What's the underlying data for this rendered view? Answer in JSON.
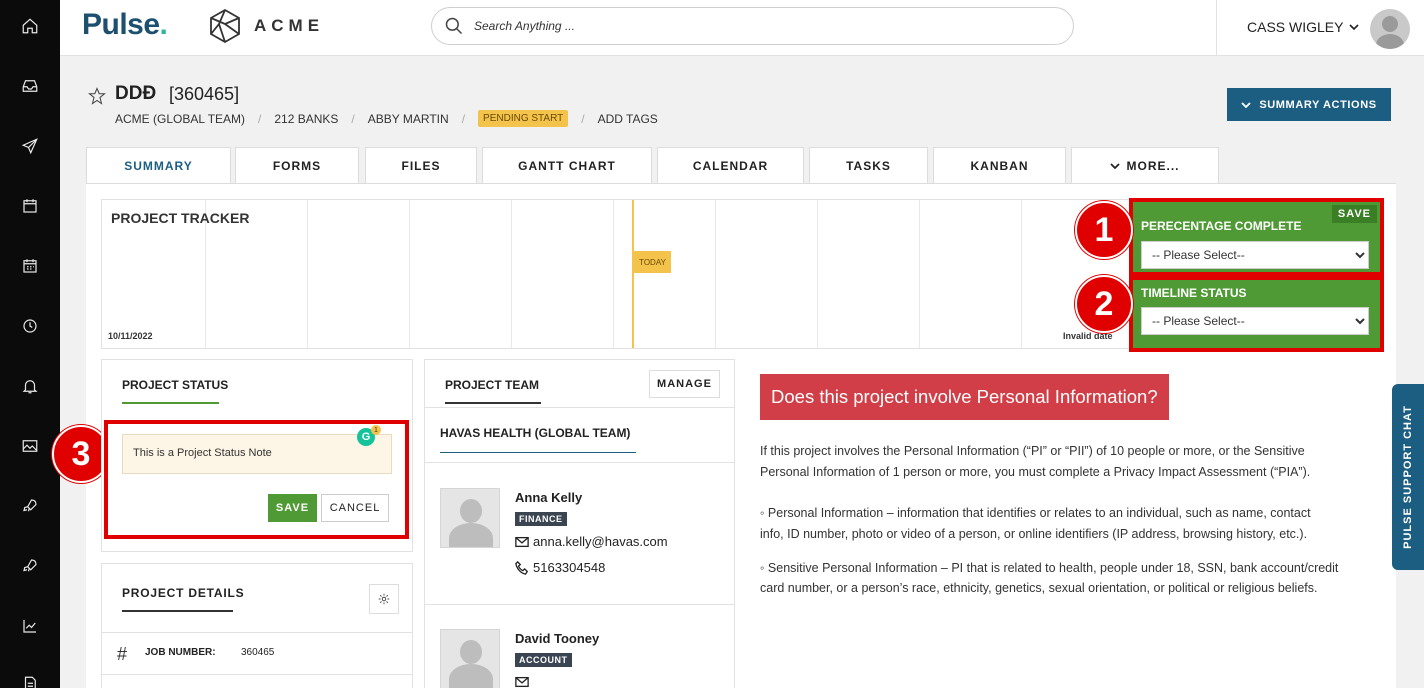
{
  "sidebar": {
    "icons": [
      "home-icon",
      "inbox-icon",
      "send-icon",
      "calendar-icon",
      "calendar-grid-icon",
      "clock-icon",
      "bell-icon",
      "image-icon",
      "rocket-icon",
      "rocket-icon-2",
      "chart-icon",
      "document-icon"
    ]
  },
  "header": {
    "logo_pulse": "Pulse",
    "logo_pulse_dot": ".",
    "logo_acme": "ACME",
    "search_placeholder": "Search Anything ...",
    "user_name": "CASS WIGLEY"
  },
  "project": {
    "title": "DDĐ",
    "id": "[360465]",
    "breadcrumbs": [
      "ACME (GLOBAL TEAM)",
      "212 BANKS",
      "ABBY MARTIN"
    ],
    "status_badge": "PENDING START",
    "add_tags": "ADD TAGS",
    "summary_actions": "SUMMARY ACTIONS"
  },
  "tabs": [
    "SUMMARY",
    "FORMS",
    "FILES",
    "GANTT CHART",
    "CALENDAR",
    "TASKS",
    "KANBAN",
    "MORE..."
  ],
  "tracker": {
    "title": "PROJECT TRACKER",
    "start_date": "10/11/2022",
    "end_date": "Invalid date",
    "today_label": "TODAY"
  },
  "fields": {
    "save_label": "SAVE",
    "percentage_label": "PERECENTAGE COMPLETE",
    "percentage_value": "-- Please Select--",
    "timeline_label": "TIMELINE STATUS",
    "timeline_value": "-- Please Select--"
  },
  "annotations": [
    "1",
    "2",
    "3"
  ],
  "project_status": {
    "heading": "PROJECT STATUS",
    "note": "This is a Project Status Note",
    "grammarly_letter": "G",
    "grammarly_count": "1",
    "save": "SAVE",
    "cancel": "CANCEL"
  },
  "project_details": {
    "heading": "PROJECT DETAILS",
    "job_number_label": "JOB NUMBER:",
    "job_number_value": "360465"
  },
  "project_team": {
    "heading": "PROJECT TEAM",
    "manage": "MANAGE",
    "team_name": "HAVAS HEALTH (GLOBAL TEAM)",
    "members": [
      {
        "name": "Anna Kelly",
        "role": "FINANCE",
        "email": "anna.kelly@havas.com",
        "phone": "5163304548"
      },
      {
        "name": "David Tooney",
        "role": "ACCOUNT",
        "email": "",
        "phone": ""
      }
    ]
  },
  "privacy": {
    "title": "Does this project involve Personal Information?",
    "intro_1": "If this project involves the Personal Information (“PI” or “PII”) of 10 people or more, or the Sensitive",
    "intro_2": "Personal Information of 1 person or more, you must complete a Privacy Impact Assessment (“PIA”).",
    "bullet1_1": "◦    Personal Information – information that identifies or relates to an individual, such as name, contact",
    "bullet1_2": "info, ID number, photo or video of a person, or online identifiers (IP address, browsing history, etc.).",
    "bullet2_1": "◦    Sensitive Personal Information – PI that is related to health, people under 18, SSN, bank account/credit",
    "bullet2_2": "card number, or a person’s race, ethnicity, genetics, sexual orientation, or political or religious beliefs."
  },
  "chat_tab": "PULSE SUPPORT CHAT"
}
